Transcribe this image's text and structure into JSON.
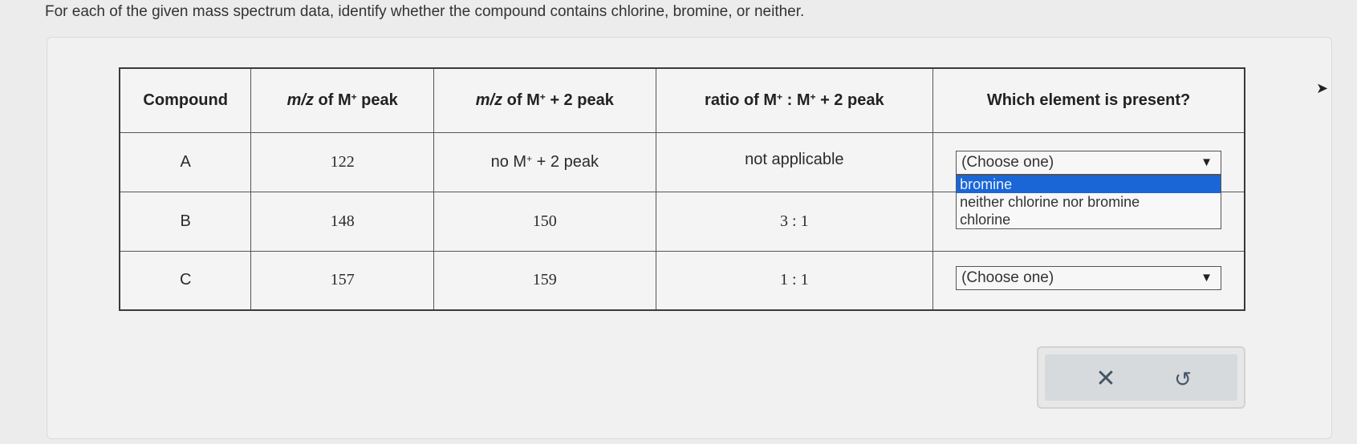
{
  "prompt": "For each of the given mass spectrum data, identify whether the compound contains chlorine, bromine, or neither.",
  "table": {
    "headers": {
      "compound": "Compound",
      "mz_m_prefix": "m/z",
      "mz_m_of": " of M",
      "mz_m_sup": "+",
      "mz_m_suffix": " peak",
      "mz_m2_prefix": "m/z",
      "mz_m2_of": " of M",
      "mz_m2_sup": "+",
      "mz_m2_suffix": " + 2 peak",
      "ratio_prefix": "ratio of M",
      "ratio_sup1": "+",
      "ratio_mid": " : M",
      "ratio_sup2": "+",
      "ratio_suffix": " + 2 peak",
      "element": "Which element is present?"
    },
    "rows": [
      {
        "compound": "A",
        "mz_m": "122",
        "mz_m2_prefix": "no M",
        "mz_m2_sup": "+",
        "mz_m2_suffix": " + 2 peak",
        "ratio": "not applicable",
        "select_value": "(Choose one)"
      },
      {
        "compound": "B",
        "mz_m": "148",
        "mz_m2": "150",
        "ratio": "3 : 1"
      },
      {
        "compound": "C",
        "mz_m": "157",
        "mz_m2": "159",
        "ratio": "1 : 1",
        "select_value": "(Choose one)"
      }
    ],
    "dropdown_options": [
      "bromine",
      "neither chlorine nor bromine",
      "chlorine"
    ],
    "highlighted_option": "bromine"
  },
  "actions": {
    "clear_glyph": "✕",
    "undo_glyph": "↺",
    "clear_icon": "close-icon",
    "undo_icon": "undo-icon"
  },
  "colors": {
    "highlight": "#1a66d6",
    "background": "#ececec"
  }
}
